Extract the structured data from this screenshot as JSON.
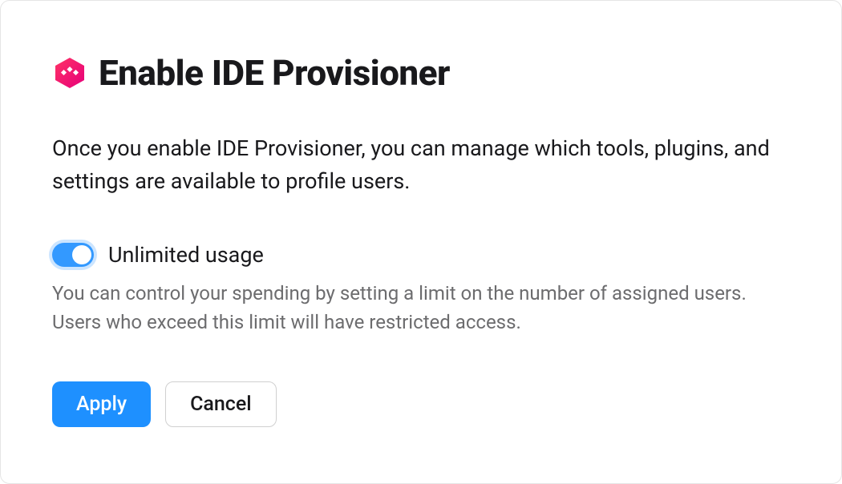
{
  "dialog": {
    "title": "Enable IDE Provisioner",
    "description": "Once you enable IDE Provisioner, you can manage which tools, plugins, and settings are available to profile users.",
    "toggle": {
      "label": "Unlimited usage",
      "enabled": true
    },
    "hint": "You can control your spending by setting a limit on the number of assigned users. Users who exceed this limit will have restricted access.",
    "buttons": {
      "apply": "Apply",
      "cancel": "Cancel"
    }
  }
}
